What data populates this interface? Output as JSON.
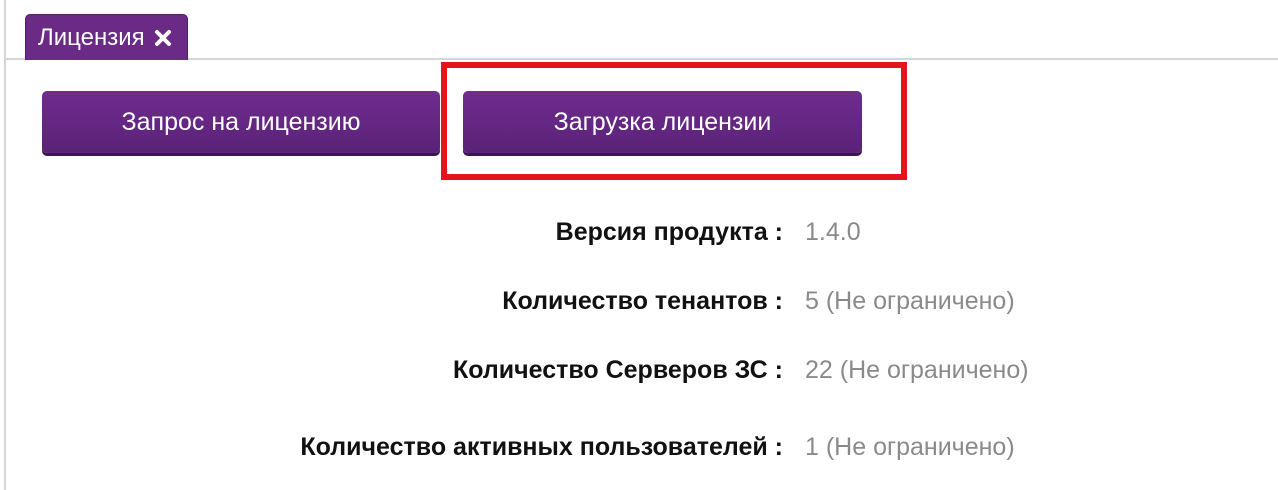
{
  "tab": {
    "label": "Лицензия",
    "close_icon": "close-icon"
  },
  "buttons": {
    "request_label": "Запрос на лицензию",
    "upload_label": "Загрузка лицензии"
  },
  "info": [
    {
      "label": "Версия продукта :",
      "value": "1.4.0"
    },
    {
      "label": "Количество тенантов :",
      "value": "5 (Не ограничено)"
    },
    {
      "label": "Количество Серверов ЗС :",
      "value": "22 (Не ограничено)"
    },
    {
      "label": "Количество активных пользователей :",
      "value": "1 (Не ограничено)"
    }
  ],
  "colors": {
    "accent": "#6a2a86",
    "highlight": "#e3141b",
    "value_text": "#8a8a8a"
  }
}
